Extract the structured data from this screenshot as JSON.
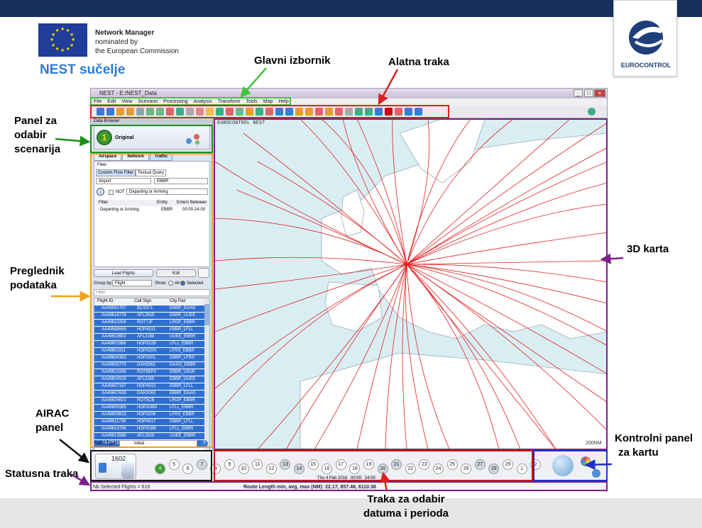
{
  "header": {
    "nm_line1": "Network Manager",
    "nm_line2": "nominated by",
    "nm_line3": "the European Commission",
    "title": "NEST sučelje",
    "eurocontrol": "EUROCONTROL"
  },
  "annotations": {
    "main_menu": "Glavni izbornik",
    "toolbar": "Alatna traka",
    "scenario_panel_l1": "Panel za",
    "scenario_panel_l2": "odabir",
    "scenario_panel_l3": "scenarija",
    "data_browser_l1": "Preglednik",
    "data_browser_l2": "podataka",
    "airac_l1": "AIRAC",
    "airac_l2": "panel",
    "status_bar": "Statusna traka",
    "map_3d": "3D karta",
    "map_control_l1": "Kontrolni panel",
    "map_control_l2": "za kartu",
    "date_bar_l1": "Traka za odabir",
    "date_bar_l2": "datuma i perioda"
  },
  "window": {
    "title": "NEST - E:/NEST_Data",
    "menu": [
      "File",
      "Edit",
      "View",
      "Scenario",
      "Processing",
      "Analysis",
      "Transform",
      "Tools",
      "Map",
      "Help"
    ],
    "map_label": "EUROCONTROL NEST",
    "scale": "200NM"
  },
  "left_panel": {
    "header": "Data Browser",
    "scenario": "Original",
    "scenario_num": "1",
    "tabs": [
      "Airspace",
      "Network",
      "Traffic"
    ],
    "filter": "Filter",
    "subtabs": [
      "Custom Flow Filter",
      "Textual Query"
    ],
    "entity_type": "Airport",
    "entity_value": "EBBR",
    "not_label": "NOT",
    "condition": "Departing or Arriving",
    "cols": [
      "Filter",
      "Entity",
      "Enters Between"
    ],
    "filter_row": [
      "Departing or Arriving",
      "EBBR",
      "00:00-24:00"
    ],
    "load_button": "Load Flights",
    "count": "616",
    "group_label": "Group by:",
    "group_value": "Flight",
    "show_label": "Show:",
    "show_all": "All",
    "show_selected": "Selected",
    "search_placeholder": "Filter",
    "flight_cols": [
      "Flight ID",
      "Call Sign",
      "City Pair"
    ],
    "flights": [
      [
        "AA49591707",
        "BCS371",
        "EBBR_EGNX"
      ],
      [
        "AA49618776",
        "AFL2619",
        "EBBR_UUEE"
      ],
      [
        "AA49610258",
        "ROT7JF",
        "LROP_EBBR"
      ],
      [
        "AA49598659",
        "HOP4311",
        "EBBR_LFLL"
      ],
      [
        "AA49619902",
        "AFL2168",
        "UUEE_EBBR"
      ],
      [
        "AA49601986",
        "HOP312B",
        "LFLL_EBBR"
      ],
      [
        "AA49601911",
        "HOP320N",
        "LFRS_EBBR"
      ],
      [
        "AA49604393",
        "HOP3201",
        "EBBR_LFRS"
      ],
      [
        "AA49603775",
        "DAH2062",
        "DAAG_EBBR"
      ],
      [
        "AA49610268",
        "ROT65PX",
        "EBBR_LROP"
      ],
      [
        "AA49624526",
        "AFL2169",
        "EBBR_UUEE"
      ],
      [
        "AA49607197",
        "HOP4313",
        "EBBR_LFLL"
      ],
      [
        "AA49607639",
        "DAH2063",
        "EBBR_DAAG"
      ],
      [
        "AA49624621",
        "ROT5CB",
        "LROP_EBBR"
      ],
      [
        "AA49609385",
        "HOP316M",
        "LFLL_EBBR"
      ],
      [
        "AA49609815",
        "HOP3206",
        "LFRS_EBBR"
      ],
      [
        "AA49611739",
        "HOP431T",
        "EBBR_LFLL"
      ],
      [
        "AA49613796",
        "HOP318B",
        "LFLL_EBBR"
      ],
      [
        "AA49613586",
        "AFL2618",
        "UUEE_EBBR"
      ],
      [
        "AA49612263",
        "HOP3207",
        "EBBR_LFRS"
      ]
    ],
    "traffic_type_label": "Traffic Type:",
    "traffic_type_value": "Initial"
  },
  "bottom": {
    "airac": "1602",
    "days": [
      "4",
      "5",
      "6",
      "7",
      "8",
      "9",
      "10",
      "11",
      "12",
      "13",
      "14",
      "15",
      "16",
      "17",
      "18",
      "19",
      "20",
      "21",
      "22",
      "23",
      "24",
      "25",
      "26",
      "27",
      "28",
      "29",
      "1",
      "2"
    ],
    "date_text": "Thu 4 Feb 2016",
    "time_start": "00:00",
    "time_end": "24:00"
  },
  "status": {
    "left": "Nb Selected Flights = 616",
    "right": "Route Length min, avg, max (NM): 22.17, 857.48, 6110.38"
  },
  "colors": {
    "route": "#e02020",
    "accent": "#2f6fd1",
    "land": "#ffffff",
    "sea": "#d9eef3"
  }
}
